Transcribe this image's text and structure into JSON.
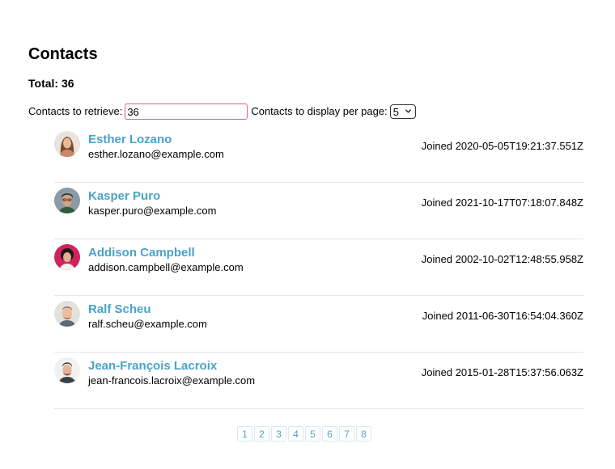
{
  "page": {
    "title": "Contacts",
    "total_label": "Total: 36"
  },
  "controls": {
    "retrieve_label": "Contacts to retrieve:",
    "retrieve_value": "36",
    "per_page_label": "Contacts to display per page:",
    "per_page_value": "5"
  },
  "contacts": [
    {
      "name": "Esther Lozano",
      "email": "esther.lozano@example.com",
      "joined": "Joined 2020-05-05T19:21:37.551Z",
      "avatar_icon": "woman-portrait-icon"
    },
    {
      "name": "Kasper Puro",
      "email": "kasper.puro@example.com",
      "joined": "Joined 2021-10-17T07:18:07.848Z",
      "avatar_icon": "man-portrait-icon"
    },
    {
      "name": "Addison Campbell",
      "email": "addison.campbell@example.com",
      "joined": "Joined 2002-10-02T12:48:55.958Z",
      "avatar_icon": "woman-portrait-icon"
    },
    {
      "name": "Ralf Scheu",
      "email": "ralf.scheu@example.com",
      "joined": "Joined 2011-06-30T16:54:04.360Z",
      "avatar_icon": "man-portrait-icon"
    },
    {
      "name": "Jean-François Lacroix",
      "email": "jean-francois.lacroix@example.com",
      "joined": "Joined 2015-01-28T15:37:56.063Z",
      "avatar_icon": "man-portrait-icon"
    }
  ],
  "pagination": {
    "pages": [
      "1",
      "2",
      "3",
      "4",
      "5",
      "6",
      "7",
      "8"
    ]
  },
  "colors": {
    "link": "#4aa3c8",
    "input_border": "#e05a9c",
    "divider": "#e6e6e6"
  }
}
